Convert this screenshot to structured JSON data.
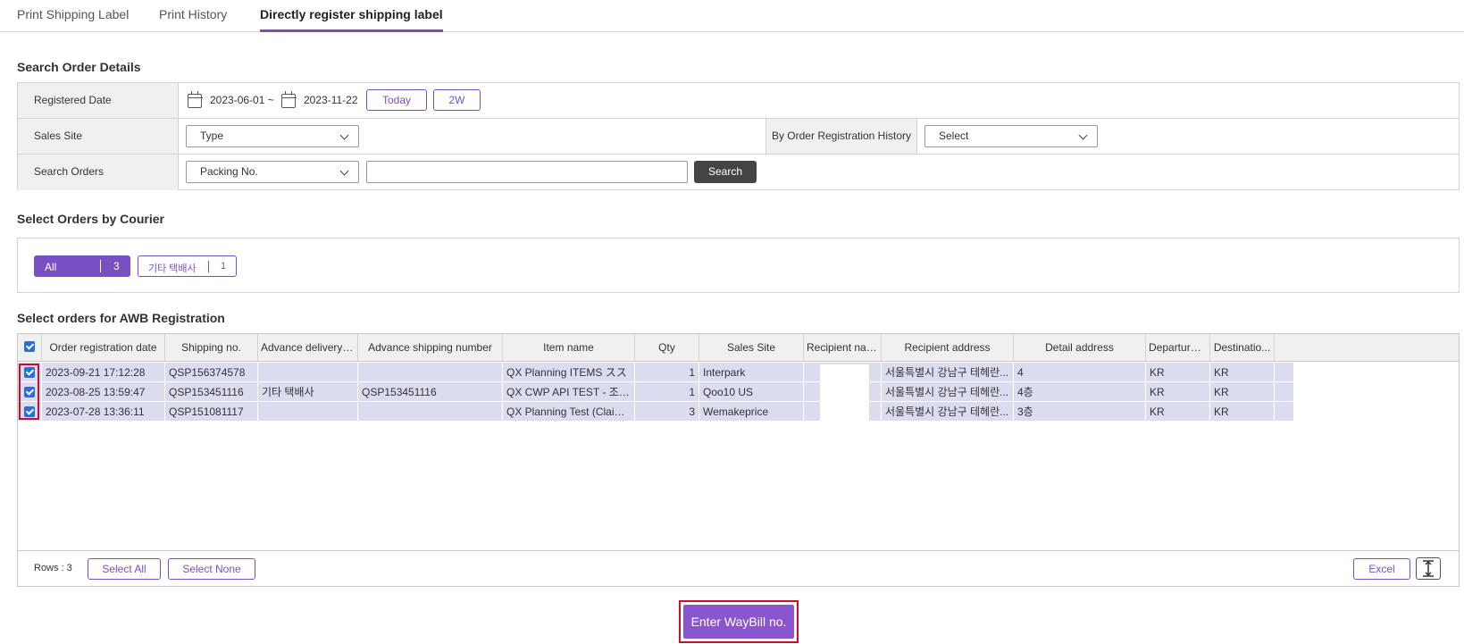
{
  "tabs": [
    {
      "label": "Print Shipping Label"
    },
    {
      "label": "Print History"
    },
    {
      "label": "Directly register shipping label"
    }
  ],
  "search": {
    "title": "Search Order Details",
    "registered_date_label": "Registered Date",
    "date_from": "2023-06-01 ~",
    "date_to": "2023-11-22",
    "today_label": "Today",
    "two_week_label": "2W",
    "sales_site_label": "Sales Site",
    "sales_site_value": "Type",
    "order_history_label": "By Order Registration History",
    "order_history_value": "Select",
    "search_orders_label": "Search Orders",
    "search_type_value": "Packing No.",
    "search_text_value": "",
    "search_button_label": "Search"
  },
  "courier": {
    "title": "Select Orders by Courier",
    "chips": [
      {
        "label": "All",
        "count": "3"
      },
      {
        "label": "기타 택배사",
        "count": "1"
      }
    ]
  },
  "grid": {
    "title": "Select orders for AWB Registration",
    "columns": [
      "Order registration date",
      "Shipping no.",
      "Advance delivery c...",
      "Advance shipping number",
      "Item name",
      "Qty",
      "Sales Site",
      "Recipient name",
      "Recipient address",
      "Detail address",
      "Departure ...",
      "Destinatio..."
    ],
    "rows": [
      {
        "date": "2023-09-21 17:12:28",
        "shipping_no": "QSP156374578",
        "adv_courier": "",
        "adv_number": "",
        "item": "QX Planning ITEMS スス",
        "qty": "1",
        "site": "Interpark",
        "recipient": "",
        "address": "서울특별시 강남구 테헤란...",
        "detail": "4",
        "departure": "KR",
        "destination": "KR"
      },
      {
        "date": "2023-08-25 13:59:47",
        "shipping_no": "QSP153451116",
        "adv_courier": "기타 택배사",
        "adv_number": "QSP153451116",
        "item": "QX CWP API TEST - 조합...",
        "qty": "1",
        "site": "Qoo10 US",
        "recipient": "",
        "address": "서울특별시 강남구 테헤란...",
        "detail": "4층",
        "departure": "KR",
        "destination": "KR"
      },
      {
        "date": "2023-07-28 13:36:11",
        "shipping_no": "QSP151081117",
        "adv_courier": "",
        "adv_number": "",
        "item": "QX Planning Test (Claim ...",
        "qty": "3",
        "site": "Wemakeprice",
        "recipient": "",
        "address": "서울특별시 강남구 테헤란...",
        "detail": "3층",
        "departure": "KR",
        "destination": "KR"
      }
    ],
    "rows_label": "Rows : 3",
    "select_all_label": "Select All",
    "select_none_label": "Select None",
    "excel_label": "Excel"
  },
  "enter_waybill_label": "Enter WayBill no.",
  "colors": {
    "accent": "#7b4fc4",
    "primary_button": "#8a56cf",
    "row_selected": "#dcdcf0",
    "highlight_box": "#c8102e"
  }
}
